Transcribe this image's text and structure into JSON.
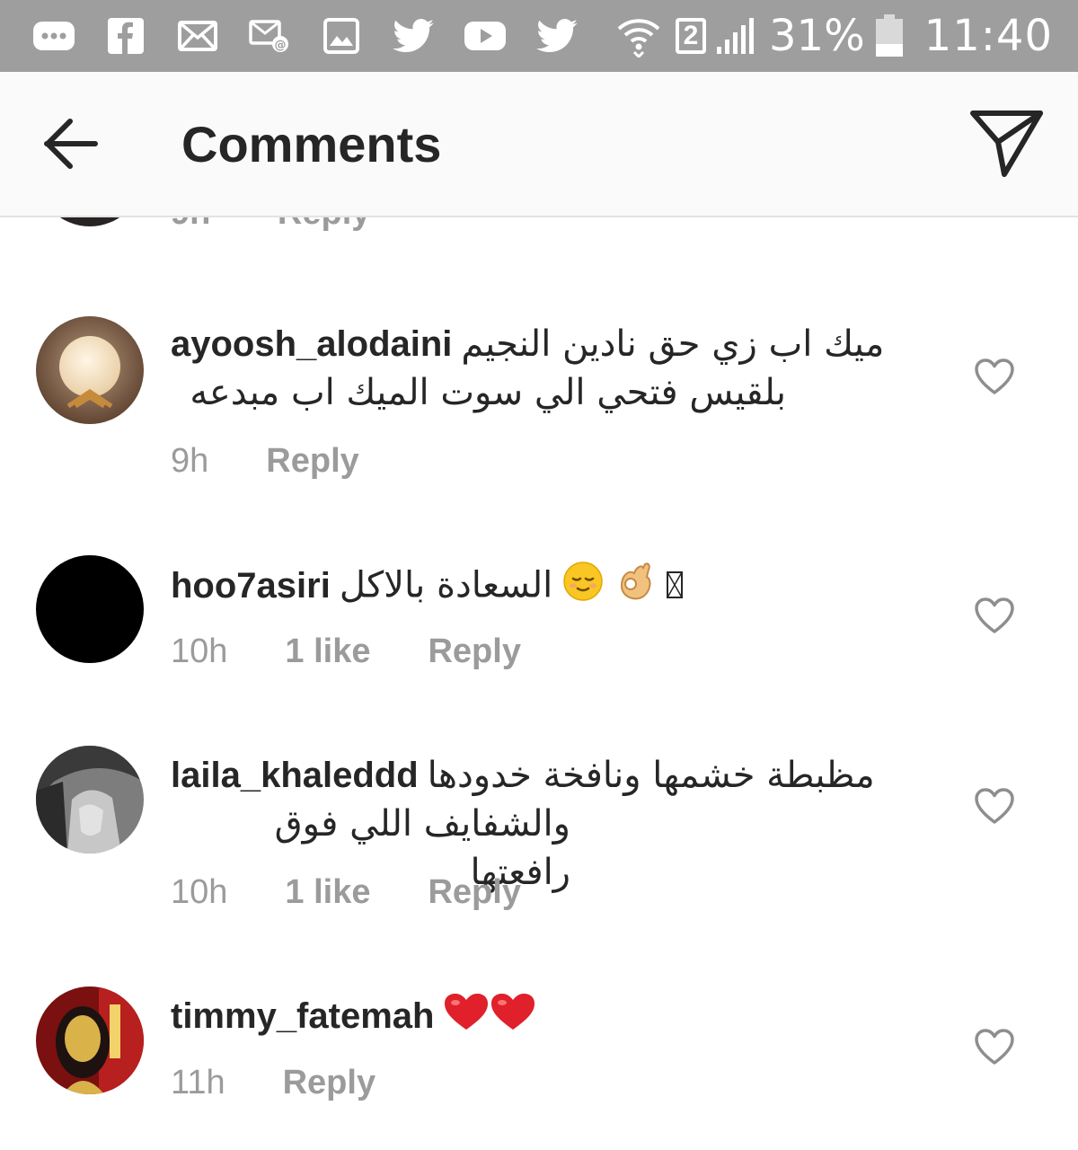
{
  "status_bar": {
    "battery": "31%",
    "time": "11:40",
    "sim": "2",
    "icons": [
      "more-icon",
      "facebook-icon",
      "email-icon",
      "mail-sync-icon",
      "gallery-icon",
      "twitter-icon",
      "youtube-icon",
      "twitter-icon",
      "wifi-icon",
      "sim-icon",
      "signal-icon",
      "battery-icon"
    ]
  },
  "header": {
    "title": "Comments"
  },
  "partial": {
    "time": "9h",
    "reply": "Reply"
  },
  "comments": [
    {
      "username": "ayoosh_alodaini",
      "text_line1": "ميك اب زي حق نادين النجيم",
      "text_line2": "بلقيس فتحي  الي سوت الميك اب  مبدعه",
      "time": "9h",
      "likes": "",
      "reply": "Reply"
    },
    {
      "username": "hoo7asiri",
      "text_line1": "السعادة بالاكل",
      "text_line2": "",
      "time": "10h",
      "likes": "1 like",
      "reply": "Reply"
    },
    {
      "username": "laila_khaleddd",
      "text_line1": "مظبطة خشمها ونافخة خدودها",
      "text_line2": "والشفايف اللي فوق رافعتها",
      "time": "10h",
      "likes": "1 like",
      "reply": "Reply"
    },
    {
      "username": "timmy_fatemah",
      "text_line1": "",
      "text_line2": "",
      "time": "11h",
      "likes": "",
      "reply": "Reply"
    }
  ],
  "colors": {
    "status_bar": "#9e9e9e",
    "header_bg": "#fafafa",
    "text": "#262626",
    "meta": "#9b9b9b",
    "heart_red": "#e0202a"
  }
}
